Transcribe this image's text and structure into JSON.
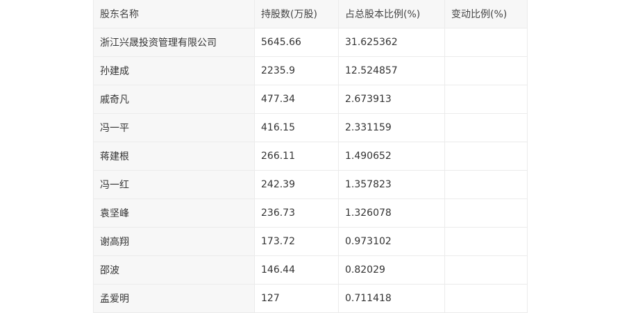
{
  "table": {
    "headers": [
      "股东名称",
      "持股数(万股)",
      "占总股本比例(%)",
      "变动比例(%)"
    ],
    "rows": [
      [
        "浙江兴晟投资管理有限公司",
        "5645.66",
        "31.625362",
        ""
      ],
      [
        "孙建成",
        "2235.9",
        "12.524857",
        ""
      ],
      [
        "戚奇凡",
        "477.34",
        "2.673913",
        ""
      ],
      [
        "冯一平",
        "416.15",
        "2.331159",
        ""
      ],
      [
        "蒋建根",
        "266.11",
        "1.490652",
        ""
      ],
      [
        "冯一红",
        "242.39",
        "1.357823",
        ""
      ],
      [
        "袁坚峰",
        "236.73",
        "1.326078",
        ""
      ],
      [
        "谢高翔",
        "173.72",
        "0.973102",
        ""
      ],
      [
        "邵波",
        "146.44",
        "0.82029",
        ""
      ],
      [
        "孟爱明",
        "127",
        "0.711418",
        ""
      ]
    ]
  }
}
